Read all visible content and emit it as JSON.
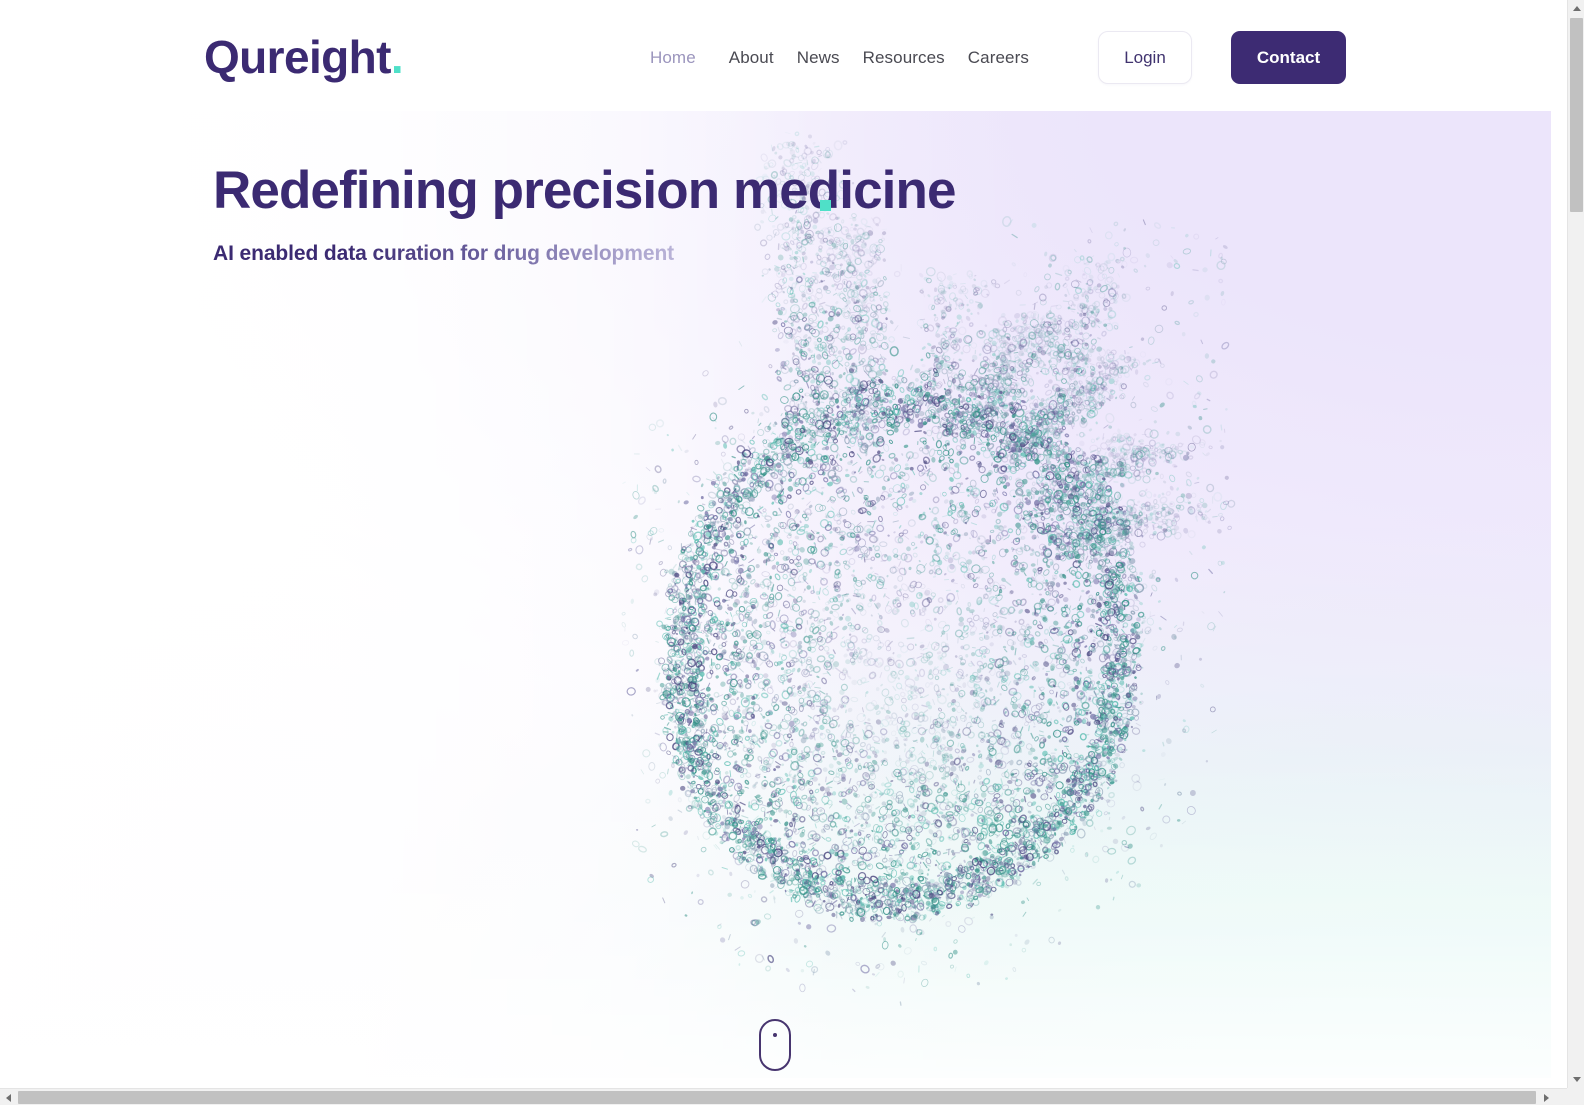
{
  "brand": {
    "name": "Qureight",
    "dot": ".",
    "color": "#3b2a72",
    "accent": "#4fe0c8"
  },
  "nav": {
    "items": [
      {
        "label": "Home",
        "active": true
      },
      {
        "label": "About",
        "active": false
      },
      {
        "label": "News",
        "active": false
      },
      {
        "label": "Resources",
        "active": false
      },
      {
        "label": "Careers",
        "active": false
      }
    ],
    "login_label": "Login",
    "contact_label": "Contact",
    "contact_bg": "#3d2b73"
  },
  "hero": {
    "title": "Redefining precision medicine",
    "subtitle": "AI enabled data curation for drug development",
    "title_color": "#3b2a72",
    "caret_color": "#4fe0c8",
    "visual": "particle-heart",
    "particle_colors": [
      "#5fbfb3",
      "#4a9e96",
      "#6f6ca3",
      "#4a4780",
      "#8fa3b8",
      "#2f8f85"
    ],
    "background_colors": {
      "lavender": "#ece5fb",
      "mint": "#e9fbf7",
      "white": "#ffffff"
    }
  },
  "scroll_cue": {
    "name": "scroll-down-mouse",
    "color": "#47356f"
  },
  "scrollbars": {
    "vertical": {
      "position": "right",
      "thumb_color": "#c1c1c1",
      "track_color": "#f1f1f1"
    },
    "horizontal": {
      "position": "bottom",
      "thumb_color": "#c1c1c1",
      "track_color": "#f1f1f1"
    }
  }
}
